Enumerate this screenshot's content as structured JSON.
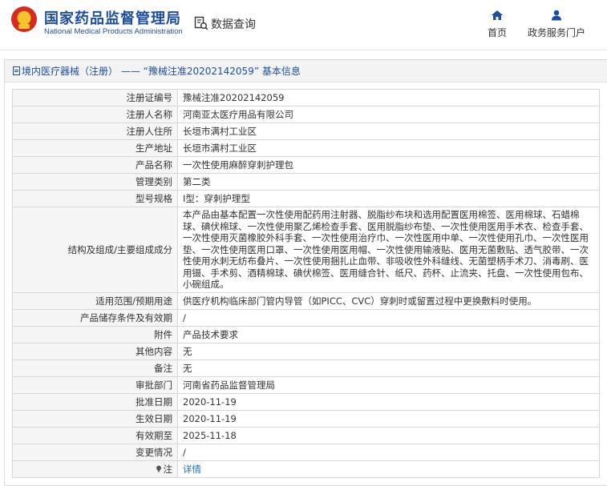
{
  "header": {
    "site_title": "国家药品监督管理局",
    "site_subtitle": "National Medical Products Administration",
    "query_label": "数据查询",
    "nav": {
      "home": "首页",
      "gov_service": "政务服务门户"
    }
  },
  "panel": {
    "title": "境内医疗器械（注册） —— “豫械注准20202142059” 基本信息"
  },
  "fields": [
    {
      "label": "注册证编号",
      "value": "豫械注准20202142059"
    },
    {
      "label": "注册人名称",
      "value": "河南亚太医疗用品有限公司"
    },
    {
      "label": "注册人住所",
      "value": "长垣市满村工业区"
    },
    {
      "label": "生产地址",
      "value": "长垣市满村工业区"
    },
    {
      "label": "产品名称",
      "value": "一次性使用麻醉穿刺护理包"
    },
    {
      "label": "管理类别",
      "value": "第二类"
    },
    {
      "label": "型号规格",
      "value": "I型：穿刺护理型"
    },
    {
      "label": "结构及组成/主要组成成分",
      "value": "本产品由基本配置一次性使用配药用注射器、脱脂纱布块和选用配置医用棉签、医用棉球、石蜡棉球、碘伏棉球、一次性使用聚乙烯检查手套、医用脱脂纱布垫、一次性使用医用手术衣、检查手套、一次性使用灭菌橡胶外科手套、一次性使用治疗巾、一次性医用中单、一次性使用孔巾、一次性医用垫、一次性使用医用口罩、一次性使用医用帽、一次性使用输液贴、医用无菌敷贴、透气胶带、一次性使用水刺无纺布叠片、一次性使用捆扎止血带、非吸收性外科缝线、无菌塑柄手术刀、消毒刷、医用镊、手术剪、酒精棉球、碘伏棉签、医用缝合针、纸尺、药杯、止流夹、托盘、一次性使用包布、小碗组成。"
    },
    {
      "label": "适用范围/预期用途",
      "value": "供医疗机构临床部门管内导管（如PICC、CVC）穿刺时或留置过程中更换敷料时使用。"
    },
    {
      "label": "产品储存条件及有效期",
      "value": "/"
    },
    {
      "label": "附件",
      "value": "产品技术要求"
    },
    {
      "label": "其他内容",
      "value": "无"
    },
    {
      "label": "备注",
      "value": "无"
    },
    {
      "label": "审批部门",
      "value": "河南省药品监督管理局"
    },
    {
      "label": "批准日期",
      "value": "2020-11-19"
    },
    {
      "label": "生效日期",
      "value": "2020-11-19"
    },
    {
      "label": "有效期至",
      "value": "2025-11-18"
    },
    {
      "label": "变更情况",
      "value": "/"
    }
  ],
  "note": {
    "label": "注",
    "link": "详情"
  },
  "colors": {
    "brand_blue": "#1d4e9e",
    "link_blue": "#1d6bc7",
    "emblem_red": "#d62b1f"
  }
}
